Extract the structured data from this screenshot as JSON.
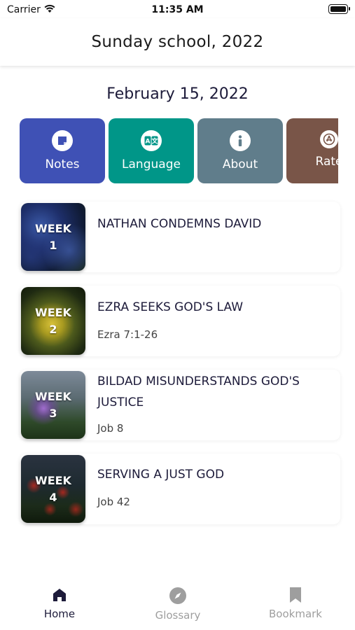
{
  "status_bar": {
    "carrier": "Carrier",
    "time": "11:35 AM"
  },
  "header": {
    "title": "Sunday school, 2022"
  },
  "date": "February 15, 2022",
  "actions": [
    {
      "label": "Notes",
      "icon": "note-icon",
      "color": "#3f51b5"
    },
    {
      "label": "Language",
      "icon": "translate-icon",
      "color": "#009688"
    },
    {
      "label": "About",
      "icon": "info-icon",
      "color": "#607d8b"
    },
    {
      "label": "Rate",
      "icon": "rate-icon",
      "color": "#795548"
    }
  ],
  "lessons": [
    {
      "week_label": "WEEK",
      "week_number": "1",
      "title": "NATHAN CONDEMNS DAVID",
      "reference": ""
    },
    {
      "week_label": "WEEK",
      "week_number": "2",
      "title": "EZRA SEEKS GOD'S LAW",
      "reference": "Ezra 7:1-26"
    },
    {
      "week_label": "WEEK",
      "week_number": "3",
      "title": "BILDAD MISUNDERSTANDS GOD'S JUSTICE",
      "reference": "Job 8"
    },
    {
      "week_label": "WEEK",
      "week_number": "4",
      "title": "SERVING A JUST GOD",
      "reference": "Job 42"
    }
  ],
  "bottom_nav": [
    {
      "label": "Home",
      "icon": "home-icon",
      "active": true
    },
    {
      "label": "Glossary",
      "icon": "compass-icon",
      "active": false
    },
    {
      "label": "Bookmark",
      "icon": "bookmark-icon",
      "active": false
    }
  ],
  "colors": {
    "active_nav": "#1d1b3a",
    "inactive_nav": "#9e9e9e"
  }
}
